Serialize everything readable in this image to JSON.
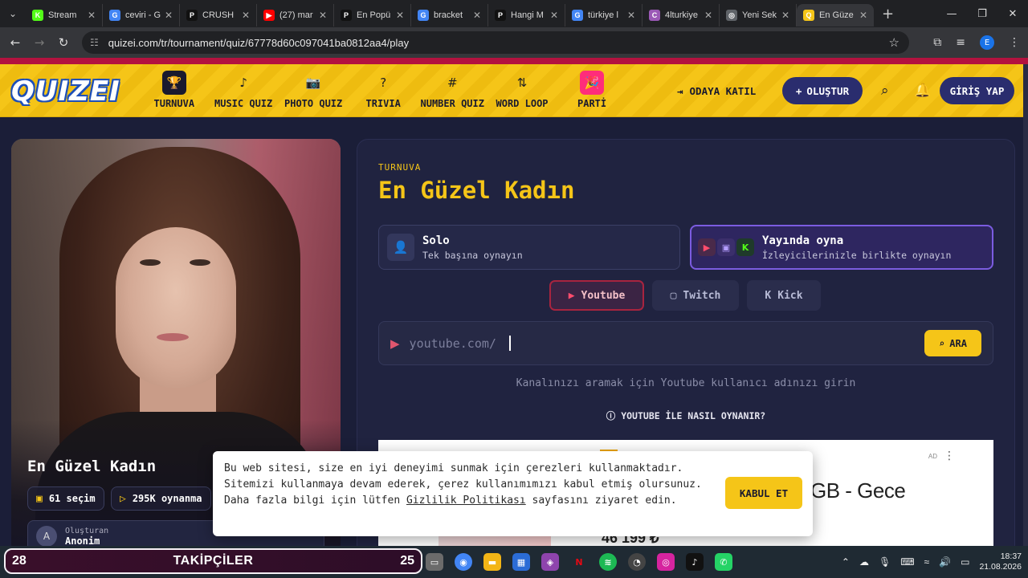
{
  "browser": {
    "tabs": [
      {
        "title": "Stream",
        "fav": "K",
        "fav_color": "#53fc18"
      },
      {
        "title": "ceviri - G",
        "fav": "G",
        "fav_color": "#4285f4"
      },
      {
        "title": "CRUSH",
        "fav": "P",
        "fav_color": "#111111"
      },
      {
        "title": "(27) mar",
        "fav": "▶",
        "fav_color": "#ff0000"
      },
      {
        "title": "En Popü",
        "fav": "P",
        "fav_color": "#111111"
      },
      {
        "title": "bracket",
        "fav": "G",
        "fav_color": "#4285f4"
      },
      {
        "title": "Hangi M",
        "fav": "P",
        "fav_color": "#111111"
      },
      {
        "title": "türkiye l",
        "fav": "G",
        "fav_color": "#4285f4"
      },
      {
        "title": "4lturkiye",
        "fav": "C",
        "fav_color": "#9b59b6"
      },
      {
        "title": "Yeni Sek",
        "fav": "◎",
        "fav_color": "#5f6368"
      },
      {
        "title": "En Güze",
        "fav": "Q",
        "fav_color": "#f5c518"
      }
    ],
    "url": "quizei.com/tr/tournament/quiz/67778d60c097041ba0812aa4/play",
    "profile_initial": "E"
  },
  "site": {
    "logo": "QUIZEI",
    "nav": [
      {
        "label": "TURNUVA",
        "icon": "🏆",
        "icon_name": "trophy-icon"
      },
      {
        "label": "MUSIC QUIZ",
        "icon": "♪",
        "icon_name": "music-note-icon"
      },
      {
        "label": "PHOTO QUIZ",
        "icon": "📷",
        "icon_name": "camera-icon"
      },
      {
        "label": "TRIVIA",
        "icon": "?",
        "icon_name": "question-icon"
      },
      {
        "label": "NUMBER QUIZ",
        "icon": "#",
        "icon_name": "hash-icon"
      },
      {
        "label": "WORD LOOP",
        "icon": "⇅",
        "icon_name": "sort-icon"
      },
      {
        "label": "PARTİ",
        "icon": "🎉",
        "icon_name": "party-icon"
      }
    ],
    "join_room": "ODAYA KATIL",
    "create": "OLUŞTUR",
    "login": "GİRİŞ YAP"
  },
  "quiz": {
    "title": "En Güzel Kadın",
    "choices": "61 seçim",
    "plays": "295K oynanma",
    "creator_label": "Oluşturan",
    "creator_name": "Anonim",
    "creator_initial": "A"
  },
  "play": {
    "kicker": "TURNUVA",
    "title": "En Güzel Kadın",
    "solo_title": "Solo",
    "solo_desc": "Tek başına oynayın",
    "live_title": "Yayında oyna",
    "live_desc": "İzleyicilerinizle birlikte oynayın",
    "platforms": [
      "Youtube",
      "Twitch",
      "Kick"
    ],
    "search_placeholder": "youtube.com/",
    "search_button": "ARA",
    "hint": "Kanalınızı aramak için Youtube kullanıcı adınızı girin",
    "howto": "YOUTUBE İLE NASIL OYNANIR?"
  },
  "ad": {
    "label": "AD",
    "product": "GB - Gece",
    "price": "46 199 ₺"
  },
  "cookie": {
    "text_before": "Bu web sitesi, size en iyi deneyimi sunmak için çerezleri kullanmaktadır. Sitemizi kullanmaya devam ederek, çerez kullanımımızı kabul etmiş olursunuz. Daha fazla bilgi için lütfen ",
    "link": "Gizlilik Politikası",
    "text_after": " sayfasını ziyaret edin.",
    "accept": "KABUL ET"
  },
  "taskbar": {
    "left_count": "28",
    "label": "TAKİPÇİLER",
    "right_count": "25",
    "time": "18:37",
    "date": "21.08.2026"
  },
  "colors": {
    "accent": "#f5c518",
    "panel": "#202340",
    "brand_blue": "#2a2d6e"
  }
}
